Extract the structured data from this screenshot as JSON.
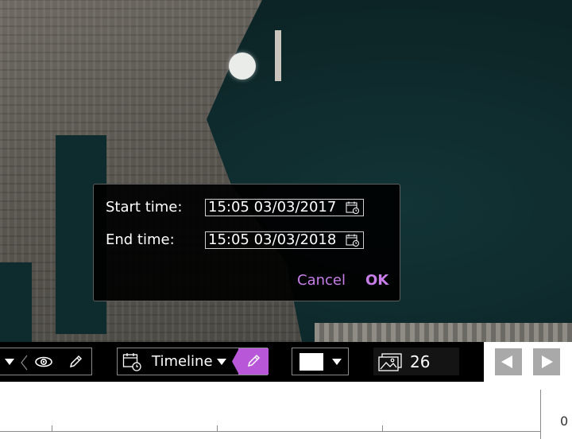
{
  "dialog": {
    "start_label": "Start time:",
    "start_value": "15:05 03/03/2017",
    "end_label": "End time:",
    "end_value": "15:05 03/03/2018",
    "cancel_label": "Cancel",
    "ok_label": "OK"
  },
  "toolbar": {
    "timeline_label": "Timeline",
    "image_count": "26"
  },
  "axis": {
    "right_label": "0"
  },
  "colors": {
    "accent": "#b857d8",
    "dialog_button": "#c77ee8",
    "toolbar_bg": "#000000"
  },
  "icons": [
    "chevron-down-icon",
    "chevron-left-icon",
    "eye-icon",
    "pencil-icon",
    "calendar-clock-icon",
    "image-stack-icon",
    "arrow-left-icon",
    "arrow-right-icon"
  ]
}
